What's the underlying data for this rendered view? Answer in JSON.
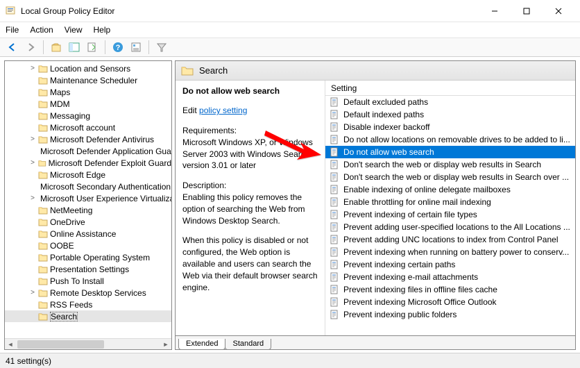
{
  "window": {
    "title": "Local Group Policy Editor",
    "menu": {
      "file": "File",
      "action": "Action",
      "view": "View",
      "help": "Help"
    }
  },
  "tree": {
    "items": [
      {
        "label": "Location and Sensors",
        "expander": ">"
      },
      {
        "label": "Maintenance Scheduler"
      },
      {
        "label": "Maps"
      },
      {
        "label": "MDM"
      },
      {
        "label": "Messaging"
      },
      {
        "label": "Microsoft account"
      },
      {
        "label": "Microsoft Defender Antivirus",
        "expander": ">"
      },
      {
        "label": "Microsoft Defender Application Guard"
      },
      {
        "label": "Microsoft Defender Exploit Guard",
        "expander": ">"
      },
      {
        "label": "Microsoft Edge"
      },
      {
        "label": "Microsoft Secondary Authentication Factor"
      },
      {
        "label": "Microsoft User Experience Virtualization",
        "expander": ">"
      },
      {
        "label": "NetMeeting"
      },
      {
        "label": "OneDrive"
      },
      {
        "label": "Online Assistance"
      },
      {
        "label": "OOBE"
      },
      {
        "label": "Portable Operating System"
      },
      {
        "label": "Presentation Settings"
      },
      {
        "label": "Push To Install"
      },
      {
        "label": "Remote Desktop Services",
        "expander": ">"
      },
      {
        "label": "RSS Feeds"
      },
      {
        "label": "Search",
        "selected": true
      }
    ]
  },
  "pane": {
    "header": "Search",
    "policy_title": "Do not allow web search",
    "edit_prefix": "Edit",
    "edit_link": "policy setting",
    "req_label": "Requirements:",
    "req_text": "Microsoft Windows XP, or Windows Server 2003 with Windows Search version 3.01 or later",
    "desc_label": "Description:",
    "desc_p1": "Enabling this policy removes the option of searching the Web from Windows Desktop Search.",
    "desc_p2": "When this policy is disabled or not configured, the Web option is available and users can search the Web via their default browser search engine.",
    "list_header": "Setting",
    "settings": [
      "Default excluded paths",
      "Default indexed paths",
      "Disable indexer backoff",
      "Do not allow locations on removable drives to be added to li...",
      "Do not allow web search",
      "Don't search the web or display web results in Search",
      "Don't search the web or display web results in Search over ...",
      "Enable indexing of online delegate mailboxes",
      "Enable throttling for online mail indexing",
      "Prevent indexing of certain file types",
      "Prevent adding user-specified locations to the All Locations ...",
      "Prevent adding UNC locations to index from Control Panel",
      "Prevent indexing when running on battery power to conserv...",
      "Prevent indexing certain paths",
      "Prevent indexing e-mail attachments",
      "Prevent indexing files in offline files cache",
      "Prevent indexing Microsoft Office Outlook",
      "Prevent indexing public folders"
    ],
    "selected_index": 4,
    "tabs": {
      "extended": "Extended",
      "standard": "Standard"
    }
  },
  "status": "41 setting(s)"
}
